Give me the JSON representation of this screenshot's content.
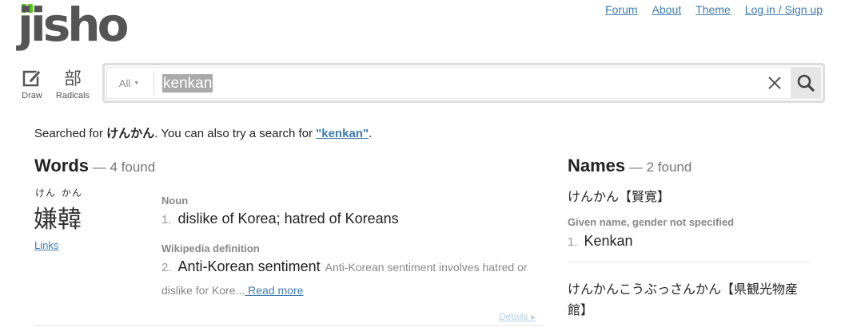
{
  "logo": {
    "text": "jisho",
    "leaf_color": "#58c322"
  },
  "nav": [
    "Forum",
    "About",
    "Theme",
    "Log in / Sign up"
  ],
  "tools": {
    "draw_label": "Draw",
    "radicals_glyph": "部",
    "radicals_label": "Radicals"
  },
  "search": {
    "scope": "All",
    "keyword": "kenkan"
  },
  "searched": {
    "prefix": "Searched for ",
    "term": "けんかん",
    "middle": ". You can also try a search for ",
    "alt": "\"kenkan\"",
    "suffix": "."
  },
  "words": {
    "heading": "Words",
    "count": " — 4 found",
    "entry": {
      "furigana": "けん かん",
      "kanji": "嫌韓",
      "links": "Links",
      "pos1": "Noun",
      "meaning1_num": "1.",
      "meaning1": "dislike of Korea; hatred of Koreans",
      "pos2": "Wikipedia definition",
      "meaning2_num": "2.",
      "meaning2": "Anti-Korean sentiment",
      "meaning2_desc": "Anti-Korean sentiment involves hatred or",
      "meaning2_cont": "dislike for Kore...",
      "read_more": " Read more",
      "details": "Details ▸"
    }
  },
  "names": {
    "heading": "Names",
    "count": " — 2 found",
    "name1": "けんかん【賢寛】",
    "given": "Given name, gender not specified",
    "meaning_num": "1.",
    "meaning": "Kenkan",
    "name2": "けんかんこうぶっさんかん【県観光物産館】"
  }
}
